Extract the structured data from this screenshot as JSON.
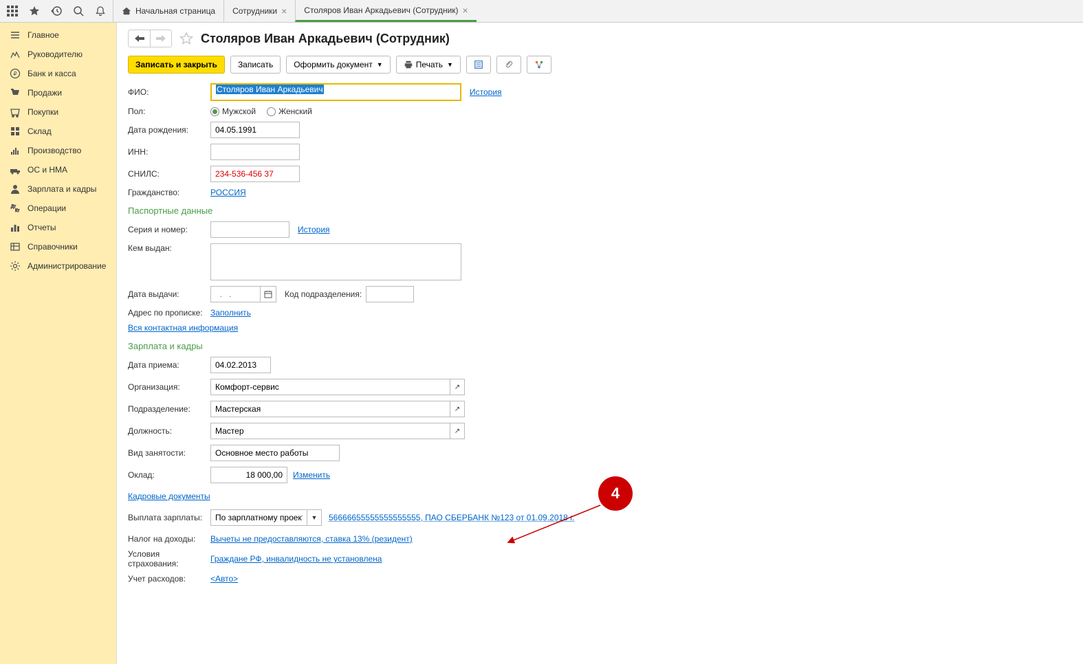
{
  "topbar": {
    "tabs": {
      "home": "Начальная страница",
      "employees": "Сотрудники",
      "current": "Столяров Иван Аркадьевич (Сотрудник)"
    }
  },
  "sidebar": {
    "items": [
      "Главное",
      "Руководителю",
      "Банк и касса",
      "Продажи",
      "Покупки",
      "Склад",
      "Производство",
      "ОС и НМА",
      "Зарплата и кадры",
      "Операции",
      "Отчеты",
      "Справочники",
      "Администрирование"
    ]
  },
  "page": {
    "title": "Столяров Иван Аркадьевич (Сотрудник)"
  },
  "toolbar": {
    "save_close": "Записать и закрыть",
    "save": "Записать",
    "create_doc": "Оформить документ",
    "print": "Печать"
  },
  "labels": {
    "fio": "ФИО:",
    "history": "История",
    "gender": "Пол:",
    "male": "Мужской",
    "female": "Женский",
    "birthdate": "Дата рождения:",
    "inn": "ИНН:",
    "snils": "СНИЛС:",
    "citizenship": "Гражданство:",
    "passport_section": "Паспортные данные",
    "series": "Серия и номер:",
    "issued_by": "Кем выдан:",
    "issue_date": "Дата выдачи:",
    "issue_date_ph": "  .   .",
    "dept_code": "Код подразделения:",
    "reg_address": "Адрес по прописке:",
    "fill": "Заполнить",
    "all_contacts": "Вся контактная информация",
    "hr_section": "Зарплата и кадры",
    "hire_date": "Дата приема:",
    "org": "Организация:",
    "dept": "Подразделение:",
    "position": "Должность:",
    "emp_type": "Вид занятости:",
    "salary": "Оклад:",
    "change": "Изменить",
    "hr_docs": "Кадровые документы",
    "salary_payment": "Выплата зарплаты:",
    "income_tax": "Налог на доходы:",
    "insurance": "Условия страхования:",
    "expenses": "Учет расходов:"
  },
  "values": {
    "fio": "Столяров Иван Аркадьевич",
    "birthdate": "04.05.1991",
    "snils": "234-536-456 37",
    "citizenship": "РОССИЯ",
    "hire_date": "04.02.2013",
    "org": "Комфорт-сервис",
    "dept": "Мастерская",
    "position": "Мастер",
    "emp_type": "Основное место работы",
    "salary": "18 000,00",
    "payment_method": "По зарплатному проекту",
    "bank_account": "56666655555555555555, ПАО СБЕРБАНК №123       от 01.09.2018 г.",
    "tax_link": "Вычеты не предоставляются, ставка 13% (резидент)",
    "insurance_link": "Граждане РФ, инвалидность не установлена",
    "expenses_link": "<Авто>"
  },
  "annotation": {
    "badge": "4"
  }
}
